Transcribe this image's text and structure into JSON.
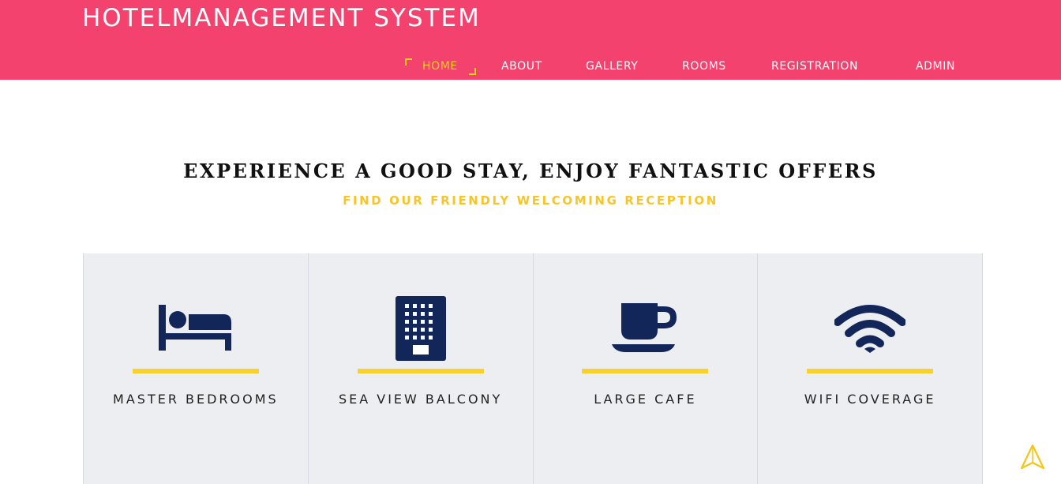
{
  "header": {
    "brand": "HOTELMANAGEMENT SYSTEM",
    "nav": [
      {
        "label": "HOME",
        "active": true
      },
      {
        "label": "ABOUT",
        "active": false
      },
      {
        "label": "GALLERY",
        "active": false
      },
      {
        "label": "ROOMS",
        "active": false
      },
      {
        "label": "REGISTRATION",
        "active": false
      },
      {
        "label": "ADMIN",
        "active": false
      }
    ]
  },
  "hero": {
    "headline": "EXPERIENCE A GOOD STAY, ENJOY FANTASTIC OFFERS",
    "subline": "FIND OUR FRIENDLY WELCOMING RECEPTION"
  },
  "features": [
    {
      "label": "MASTER BEDROOMS",
      "icon": "bed-icon"
    },
    {
      "label": "SEA VIEW BALCONY",
      "icon": "building-icon"
    },
    {
      "label": "LARGE CAFE",
      "icon": "coffee-cup-icon"
    },
    {
      "label": "WIFI COVERAGE",
      "icon": "wifi-icon"
    }
  ],
  "colors": {
    "header_bg": "#f4426f",
    "accent_yellow": "#f7d11a",
    "icon_navy": "#13265a",
    "panel_bg": "#eceef2"
  },
  "scroll_top_icon": "navigation-arrow-icon"
}
